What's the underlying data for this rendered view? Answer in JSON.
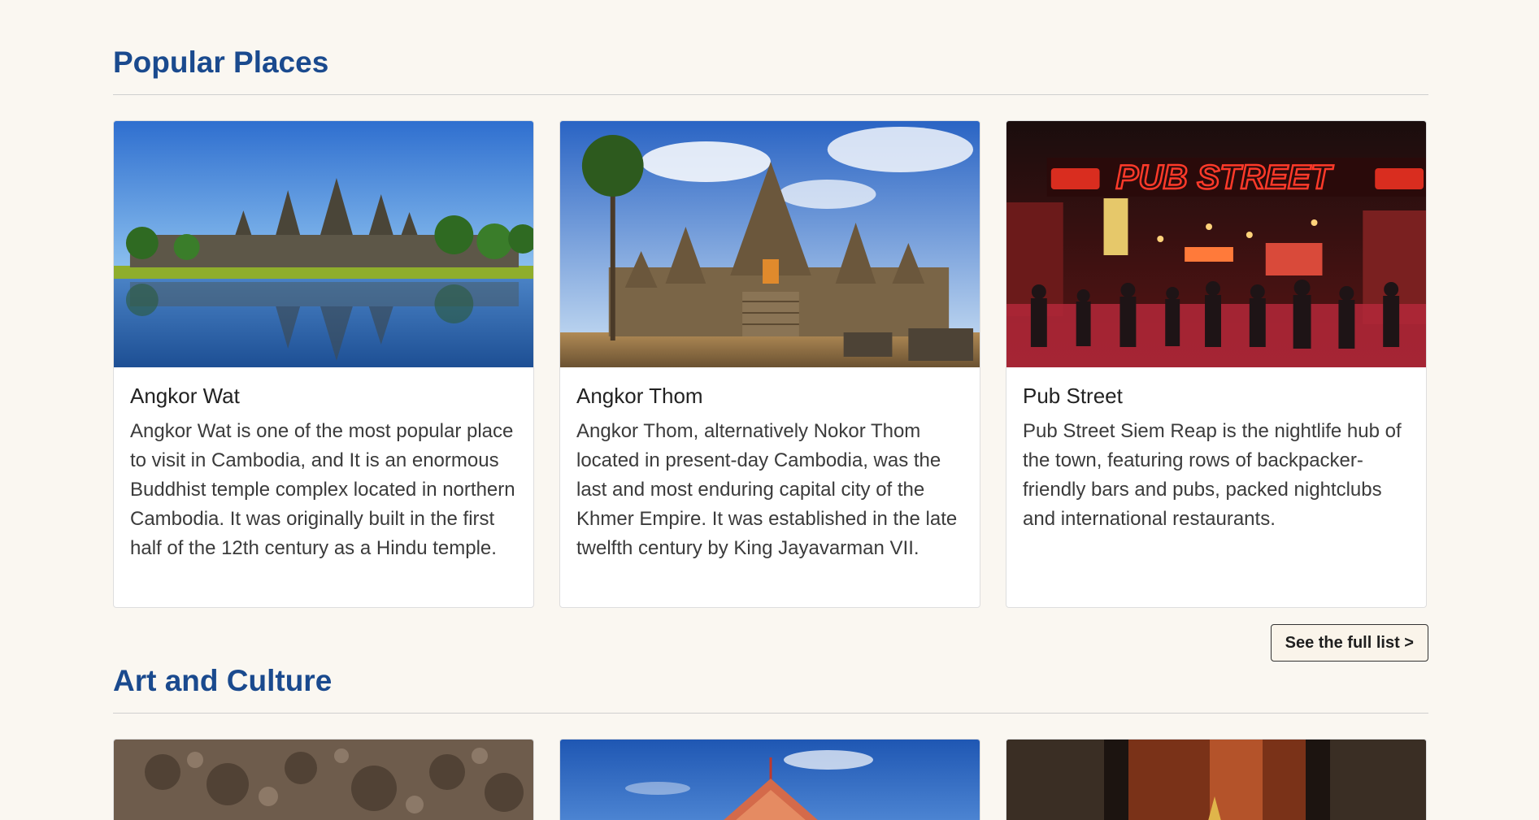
{
  "popular": {
    "title": "Popular Places",
    "cards": [
      {
        "title": "Angkor Wat",
        "text": "Angkor Wat is one of the most popular place to visit in Cambodia, and It is an enormous Buddhist temple complex located in northern Cambodia. It was originally built in the first half of the 12th century as a Hindu temple."
      },
      {
        "title": "Angkor Thom",
        "text": "Angkor Thom, alternatively Nokor Thom located in present-day Cambodia, was the last and most enduring capital city of the Khmer Empire. It was established in the late twelfth century by King Jayavarman VII."
      },
      {
        "title": "Pub Street",
        "text": "Pub Street Siem Reap is the nightlife hub of the town, featuring rows of backpacker-friendly bars and pubs, packed nightclubs and international restaurants.",
        "sign_text": "PUB STREET"
      }
    ],
    "see_full_list": "See the full list >"
  },
  "art": {
    "title": "Art and Culture"
  },
  "colors": {
    "heading": "#1a4a8e",
    "background": "#faf7f1",
    "card_border": "#dedede"
  }
}
